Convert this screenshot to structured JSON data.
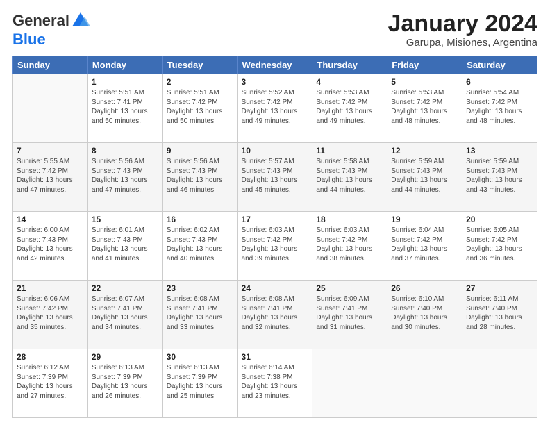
{
  "logo": {
    "general": "General",
    "blue": "Blue"
  },
  "title": "January 2024",
  "subtitle": "Garupa, Misiones, Argentina",
  "headers": [
    "Sunday",
    "Monday",
    "Tuesday",
    "Wednesday",
    "Thursday",
    "Friday",
    "Saturday"
  ],
  "weeks": [
    [
      {
        "day": "",
        "sunrise": "",
        "sunset": "",
        "daylight": ""
      },
      {
        "day": "1",
        "sunrise": "Sunrise: 5:51 AM",
        "sunset": "Sunset: 7:41 PM",
        "daylight": "Daylight: 13 hours and 50 minutes."
      },
      {
        "day": "2",
        "sunrise": "Sunrise: 5:51 AM",
        "sunset": "Sunset: 7:42 PM",
        "daylight": "Daylight: 13 hours and 50 minutes."
      },
      {
        "day": "3",
        "sunrise": "Sunrise: 5:52 AM",
        "sunset": "Sunset: 7:42 PM",
        "daylight": "Daylight: 13 hours and 49 minutes."
      },
      {
        "day": "4",
        "sunrise": "Sunrise: 5:53 AM",
        "sunset": "Sunset: 7:42 PM",
        "daylight": "Daylight: 13 hours and 49 minutes."
      },
      {
        "day": "5",
        "sunrise": "Sunrise: 5:53 AM",
        "sunset": "Sunset: 7:42 PM",
        "daylight": "Daylight: 13 hours and 48 minutes."
      },
      {
        "day": "6",
        "sunrise": "Sunrise: 5:54 AM",
        "sunset": "Sunset: 7:42 PM",
        "daylight": "Daylight: 13 hours and 48 minutes."
      }
    ],
    [
      {
        "day": "7",
        "sunrise": "Sunrise: 5:55 AM",
        "sunset": "Sunset: 7:42 PM",
        "daylight": "Daylight: 13 hours and 47 minutes."
      },
      {
        "day": "8",
        "sunrise": "Sunrise: 5:56 AM",
        "sunset": "Sunset: 7:43 PM",
        "daylight": "Daylight: 13 hours and 47 minutes."
      },
      {
        "day": "9",
        "sunrise": "Sunrise: 5:56 AM",
        "sunset": "Sunset: 7:43 PM",
        "daylight": "Daylight: 13 hours and 46 minutes."
      },
      {
        "day": "10",
        "sunrise": "Sunrise: 5:57 AM",
        "sunset": "Sunset: 7:43 PM",
        "daylight": "Daylight: 13 hours and 45 minutes."
      },
      {
        "day": "11",
        "sunrise": "Sunrise: 5:58 AM",
        "sunset": "Sunset: 7:43 PM",
        "daylight": "Daylight: 13 hours and 44 minutes."
      },
      {
        "day": "12",
        "sunrise": "Sunrise: 5:59 AM",
        "sunset": "Sunset: 7:43 PM",
        "daylight": "Daylight: 13 hours and 44 minutes."
      },
      {
        "day": "13",
        "sunrise": "Sunrise: 5:59 AM",
        "sunset": "Sunset: 7:43 PM",
        "daylight": "Daylight: 13 hours and 43 minutes."
      }
    ],
    [
      {
        "day": "14",
        "sunrise": "Sunrise: 6:00 AM",
        "sunset": "Sunset: 7:43 PM",
        "daylight": "Daylight: 13 hours and 42 minutes."
      },
      {
        "day": "15",
        "sunrise": "Sunrise: 6:01 AM",
        "sunset": "Sunset: 7:43 PM",
        "daylight": "Daylight: 13 hours and 41 minutes."
      },
      {
        "day": "16",
        "sunrise": "Sunrise: 6:02 AM",
        "sunset": "Sunset: 7:43 PM",
        "daylight": "Daylight: 13 hours and 40 minutes."
      },
      {
        "day": "17",
        "sunrise": "Sunrise: 6:03 AM",
        "sunset": "Sunset: 7:42 PM",
        "daylight": "Daylight: 13 hours and 39 minutes."
      },
      {
        "day": "18",
        "sunrise": "Sunrise: 6:03 AM",
        "sunset": "Sunset: 7:42 PM",
        "daylight": "Daylight: 13 hours and 38 minutes."
      },
      {
        "day": "19",
        "sunrise": "Sunrise: 6:04 AM",
        "sunset": "Sunset: 7:42 PM",
        "daylight": "Daylight: 13 hours and 37 minutes."
      },
      {
        "day": "20",
        "sunrise": "Sunrise: 6:05 AM",
        "sunset": "Sunset: 7:42 PM",
        "daylight": "Daylight: 13 hours and 36 minutes."
      }
    ],
    [
      {
        "day": "21",
        "sunrise": "Sunrise: 6:06 AM",
        "sunset": "Sunset: 7:42 PM",
        "daylight": "Daylight: 13 hours and 35 minutes."
      },
      {
        "day": "22",
        "sunrise": "Sunrise: 6:07 AM",
        "sunset": "Sunset: 7:41 PM",
        "daylight": "Daylight: 13 hours and 34 minutes."
      },
      {
        "day": "23",
        "sunrise": "Sunrise: 6:08 AM",
        "sunset": "Sunset: 7:41 PM",
        "daylight": "Daylight: 13 hours and 33 minutes."
      },
      {
        "day": "24",
        "sunrise": "Sunrise: 6:08 AM",
        "sunset": "Sunset: 7:41 PM",
        "daylight": "Daylight: 13 hours and 32 minutes."
      },
      {
        "day": "25",
        "sunrise": "Sunrise: 6:09 AM",
        "sunset": "Sunset: 7:41 PM",
        "daylight": "Daylight: 13 hours and 31 minutes."
      },
      {
        "day": "26",
        "sunrise": "Sunrise: 6:10 AM",
        "sunset": "Sunset: 7:40 PM",
        "daylight": "Daylight: 13 hours and 30 minutes."
      },
      {
        "day": "27",
        "sunrise": "Sunrise: 6:11 AM",
        "sunset": "Sunset: 7:40 PM",
        "daylight": "Daylight: 13 hours and 28 minutes."
      }
    ],
    [
      {
        "day": "28",
        "sunrise": "Sunrise: 6:12 AM",
        "sunset": "Sunset: 7:39 PM",
        "daylight": "Daylight: 13 hours and 27 minutes."
      },
      {
        "day": "29",
        "sunrise": "Sunrise: 6:13 AM",
        "sunset": "Sunset: 7:39 PM",
        "daylight": "Daylight: 13 hours and 26 minutes."
      },
      {
        "day": "30",
        "sunrise": "Sunrise: 6:13 AM",
        "sunset": "Sunset: 7:39 PM",
        "daylight": "Daylight: 13 hours and 25 minutes."
      },
      {
        "day": "31",
        "sunrise": "Sunrise: 6:14 AM",
        "sunset": "Sunset: 7:38 PM",
        "daylight": "Daylight: 13 hours and 23 minutes."
      },
      {
        "day": "",
        "sunrise": "",
        "sunset": "",
        "daylight": ""
      },
      {
        "day": "",
        "sunrise": "",
        "sunset": "",
        "daylight": ""
      },
      {
        "day": "",
        "sunrise": "",
        "sunset": "",
        "daylight": ""
      }
    ]
  ]
}
